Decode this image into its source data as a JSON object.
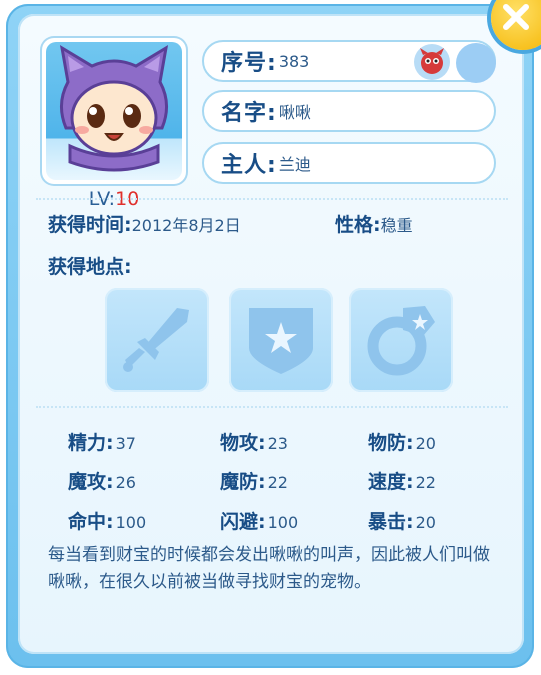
{
  "profile": {
    "level_label": "LV:",
    "level_value": "10",
    "number_label": "序号:",
    "number_value": "383",
    "name_label": "名字:",
    "name_value": "啾啾",
    "owner_label": "主人:",
    "owner_value": "兰迪"
  },
  "acquired": {
    "time_label": "获得时间:",
    "time_value": "2012年8月2日",
    "personality_label": "性格:",
    "personality_value": "稳重",
    "location_label": "获得地点:"
  },
  "equipment_slots": [
    {
      "icon": "sword-icon"
    },
    {
      "icon": "shield-icon"
    },
    {
      "icon": "ring-icon"
    }
  ],
  "stats": {
    "energy_label": "精力:",
    "energy": "37",
    "phys_atk_label": "物攻:",
    "phys_atk": "23",
    "phys_def_label": "物防:",
    "phys_def": "20",
    "mag_atk_label": "魔攻:",
    "mag_atk": "26",
    "mag_def_label": "魔防:",
    "mag_def": "22",
    "speed_label": "速度:",
    "speed": "22",
    "hit_label": "命中:",
    "hit": "100",
    "dodge_label": "闪避:",
    "dodge": "100",
    "crit_label": "暴击:",
    "crit": "20"
  },
  "description": "每当看到财宝的时候都会发出啾啾的叫声，因此被人们叫做啾啾，在很久以前被当做寻找财宝的宠物。",
  "colors": {
    "frame": "#6cc0ee",
    "panel": "#f4fbff",
    "label_text": "#184d86",
    "level_value": "#e0302c",
    "close_button": "#f4b400"
  }
}
